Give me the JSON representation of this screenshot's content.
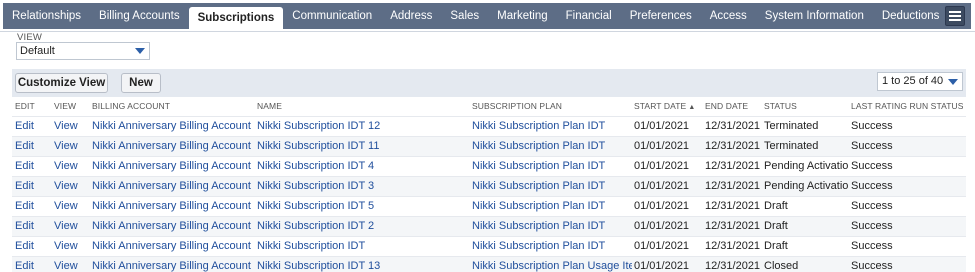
{
  "tabs": [
    {
      "label": "Relationships",
      "active": false
    },
    {
      "label": "Billing Accounts",
      "active": false
    },
    {
      "label": "Subscriptions",
      "active": true
    },
    {
      "label": "Communication",
      "active": false
    },
    {
      "label": "Address",
      "active": false
    },
    {
      "label": "Sales",
      "active": false
    },
    {
      "label": "Marketing",
      "active": false
    },
    {
      "label": "Financial",
      "active": false
    },
    {
      "label": "Preferences",
      "active": false
    },
    {
      "label": "Access",
      "active": false
    },
    {
      "label": "System Information",
      "active": false
    },
    {
      "label": "Deductions",
      "active": false
    }
  ],
  "view": {
    "label": "VIEW",
    "selected": "Default"
  },
  "toolbar": {
    "customize_label": "Customize View",
    "new_label": "New",
    "pager": "1 to 25 of 40"
  },
  "table": {
    "headers": {
      "edit": "EDIT",
      "view": "VIEW",
      "billing_account": "BILLING ACCOUNT",
      "name": "NAME",
      "subscription_plan": "SUBSCRIPTION PLAN",
      "start_date": "START DATE",
      "end_date": "END DATE",
      "status": "STATUS",
      "last_rating_run_status": "LAST RATING RUN STATUS"
    },
    "sort_indicator": "▲",
    "rows": [
      {
        "edit": "Edit",
        "view": "View",
        "billing_account": "Nikki Anniversary Billing Account IDT",
        "name": "Nikki Subscription IDT 12",
        "plan": "Nikki Subscription Plan IDT",
        "start": "01/01/2021",
        "end": "12/31/2021",
        "status": "Terminated",
        "last": "Success"
      },
      {
        "edit": "Edit",
        "view": "View",
        "billing_account": "Nikki Anniversary Billing Account IDT",
        "name": "Nikki Subscription IDT 11",
        "plan": "Nikki Subscription Plan IDT",
        "start": "01/01/2021",
        "end": "12/31/2021",
        "status": "Terminated",
        "last": "Success"
      },
      {
        "edit": "Edit",
        "view": "View",
        "billing_account": "Nikki Anniversary Billing Account IDT",
        "name": "Nikki Subscription IDT 4",
        "plan": "Nikki Subscription Plan IDT",
        "start": "01/01/2021",
        "end": "12/31/2021",
        "status": "Pending Activation",
        "last": "Success"
      },
      {
        "edit": "Edit",
        "view": "View",
        "billing_account": "Nikki Anniversary Billing Account IDT",
        "name": "Nikki Subscription IDT 3",
        "plan": "Nikki Subscription Plan IDT",
        "start": "01/01/2021",
        "end": "12/31/2021",
        "status": "Pending Activation",
        "last": "Success"
      },
      {
        "edit": "Edit",
        "view": "View",
        "billing_account": "Nikki Anniversary Billing Account IDT",
        "name": "Nikki Subscription IDT 5",
        "plan": "Nikki Subscription Plan IDT",
        "start": "01/01/2021",
        "end": "12/31/2021",
        "status": "Draft",
        "last": "Success"
      },
      {
        "edit": "Edit",
        "view": "View",
        "billing_account": "Nikki Anniversary Billing Account IDT",
        "name": "Nikki Subscription IDT 2",
        "plan": "Nikki Subscription Plan IDT",
        "start": "01/01/2021",
        "end": "12/31/2021",
        "status": "Draft",
        "last": "Success"
      },
      {
        "edit": "Edit",
        "view": "View",
        "billing_account": "Nikki Anniversary Billing Account IDT",
        "name": "Nikki Subscription IDT",
        "plan": "Nikki Subscription Plan IDT",
        "start": "01/01/2021",
        "end": "12/31/2021",
        "status": "Draft",
        "last": "Success"
      },
      {
        "edit": "Edit",
        "view": "View",
        "billing_account": "Nikki Anniversary Billing Account IDT",
        "name": "Nikki Subscription IDT 13",
        "plan": "Nikki Subscription Plan Usage Item",
        "start": "01/01/2021",
        "end": "12/31/2021",
        "status": "Closed",
        "last": "Success"
      }
    ]
  }
}
